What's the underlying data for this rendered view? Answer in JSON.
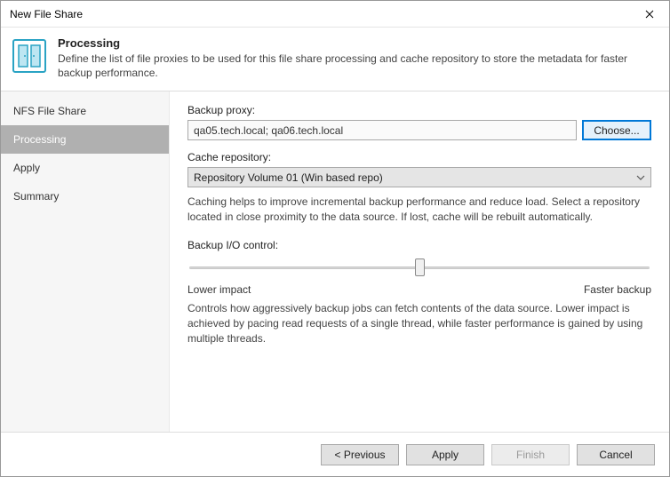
{
  "window": {
    "title": "New File Share"
  },
  "header": {
    "title": "Processing",
    "description": "Define the list of file proxies to be used for this file share processing and cache repository to store the metadata for faster backup performance."
  },
  "sidebar": {
    "items": [
      {
        "label": "NFS File Share",
        "active": false
      },
      {
        "label": "Processing",
        "active": true
      },
      {
        "label": "Apply",
        "active": false
      },
      {
        "label": "Summary",
        "active": false
      }
    ]
  },
  "content": {
    "proxy_label": "Backup proxy:",
    "proxy_value": "qa05.tech.local; qa06.tech.local",
    "choose_label": "Choose...",
    "cache_label": "Cache repository:",
    "cache_selected": "Repository Volume 01 (Win based repo)",
    "cache_help": "Caching helps to improve incremental backup performance and reduce load. Select a repository located in close proximity to the data source. If lost, cache will be rebuilt automatically.",
    "io_label": "Backup I/O control:",
    "io_low": "Lower impact",
    "io_high": "Faster backup",
    "io_help": "Controls how aggressively backup jobs can fetch contents of the data source. Lower impact is achieved by pacing read requests of a single thread, while faster performance is gained by using multiple threads."
  },
  "footer": {
    "previous": "< Previous",
    "apply": "Apply",
    "finish": "Finish",
    "cancel": "Cancel"
  }
}
